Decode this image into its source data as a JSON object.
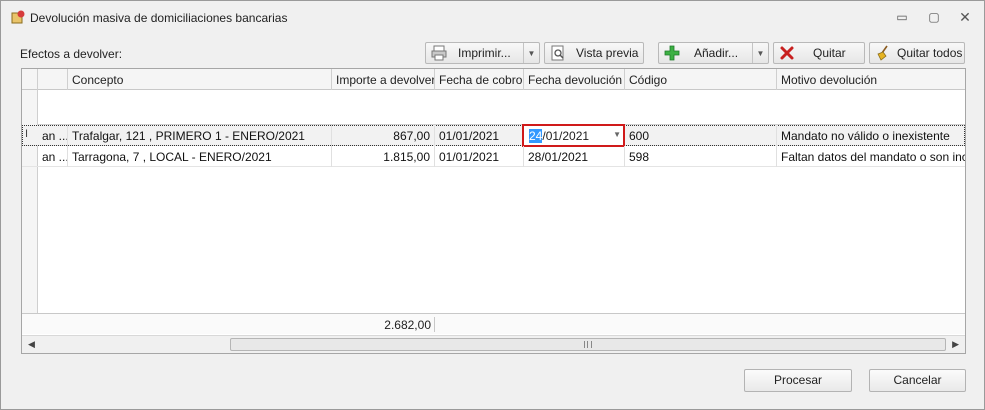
{
  "window": {
    "title": "Devolución masiva de domiciliaciones bancarias",
    "controls": {
      "minimize": "▭",
      "restore": "▢",
      "close": "✕"
    }
  },
  "section_label": "Efectos a devolver:",
  "toolbar": {
    "imprimir": "Imprimir...",
    "vista_previa": "Vista previa",
    "anadir": "Añadir...",
    "quitar": "Quitar",
    "quitar_todos": "Quitar todos"
  },
  "grid": {
    "columns": [
      "",
      "Concepto",
      "Importe a devolver",
      "Fecha de cobro",
      "Fecha devolución",
      "Código",
      "Motivo devolución"
    ],
    "rows": [
      {
        "indicator": "I",
        "first": "an ...",
        "concepto": "Trafalgar, 121 , PRIMERO 1 - ENERO/2021",
        "importe": "867,00",
        "fecha_cobro": "01/01/2021",
        "fecha_devolucion_sel": "24",
        "fecha_devolucion_rest": "/01/2021",
        "codigo": "600",
        "motivo": "Mandato no válido o inexistente"
      },
      {
        "indicator": "",
        "first": "an ...",
        "concepto": "Tarragona, 7 , LOCAL - ENERO/2021",
        "importe": "1.815,00",
        "fecha_cobro": "01/01/2021",
        "fecha_devolucion": "28/01/2021",
        "codigo": "598",
        "motivo": "Faltan datos del mandato o son inc..."
      }
    ],
    "total_importe": "2.682,00"
  },
  "buttons": {
    "procesar": "Procesar",
    "cancelar": "Cancelar"
  },
  "colors": {
    "accent_selection": "#3399ff",
    "editor_border": "#d01a1a",
    "add_icon": "#3cb043",
    "remove_icon": "#c8201f"
  }
}
